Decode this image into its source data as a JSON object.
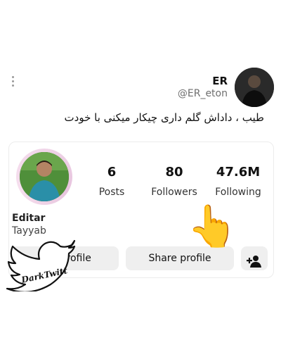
{
  "tweet": {
    "display_name": "ER",
    "handle": "@ER_eton",
    "text": "طیب ، داداش گلم داری چیکار میکنی با خودت"
  },
  "profile_card": {
    "stats": [
      {
        "value": "6",
        "label": "Posts"
      },
      {
        "value": "80",
        "label": "Followers"
      },
      {
        "value": "47.6M",
        "label": "Following"
      }
    ],
    "name": "Editar",
    "subtitle": "Tayyab",
    "buttons": {
      "edit_profile": "Edit profile",
      "share_profile": "Share profile",
      "add_person_icon": "person-add-icon"
    }
  },
  "overlay": {
    "hand_emoji": "👆",
    "watermark_text": "DarkTwitt",
    "watermark_icon": "twitter-bird-icon"
  },
  "icons": {
    "more_menu": "kebab-menu-icon"
  }
}
